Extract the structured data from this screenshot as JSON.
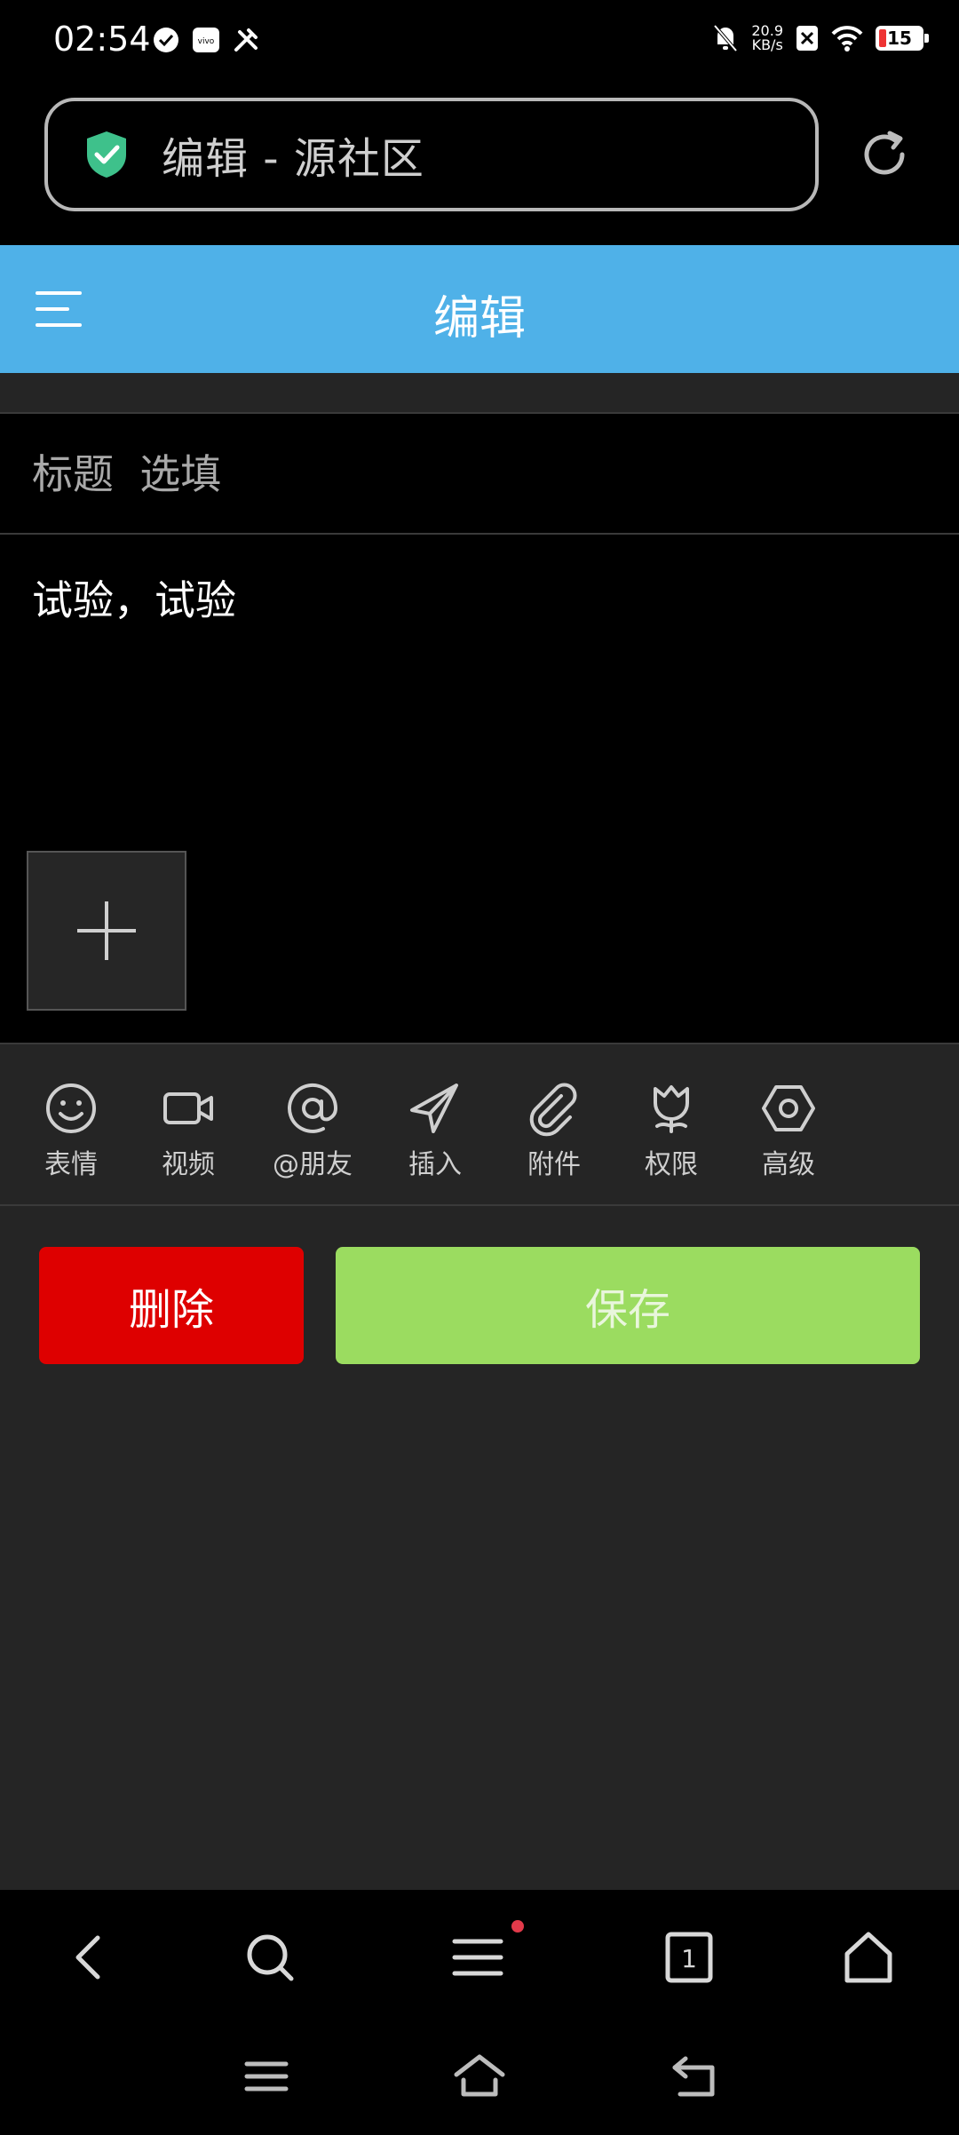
{
  "status_bar": {
    "time": "02:54",
    "net_speed_value": "20.9",
    "net_speed_unit": "KB/s",
    "battery": "15",
    "icons": [
      "check-circle-icon",
      "vivo-icon",
      "tools-icon",
      "bell-off-icon",
      "sim-off-icon",
      "wifi-icon",
      "battery-icon"
    ]
  },
  "address_bar": {
    "page_title": "编辑 - 源社区",
    "icons": [
      "shield-check-icon",
      "reload-icon"
    ]
  },
  "header": {
    "title": "编辑",
    "icons": [
      "menu-icon"
    ]
  },
  "editor": {
    "title_placeholder": "标题  选填",
    "title_value": "",
    "content": "试验，试验",
    "add_media_icon": "plus-icon"
  },
  "toolbar": {
    "items": [
      {
        "label": "表情",
        "icon": "emoji-icon"
      },
      {
        "label": "视频",
        "icon": "video-icon"
      },
      {
        "label": "@朋友",
        "icon": "at-icon"
      },
      {
        "label": "插入",
        "icon": "paper-plane-icon"
      },
      {
        "label": "附件",
        "icon": "paperclip-icon"
      },
      {
        "label": "权限",
        "icon": "tulip-icon"
      },
      {
        "label": "高级",
        "icon": "hex-gear-icon"
      }
    ]
  },
  "actions": {
    "delete_label": "删除",
    "save_label": "保存"
  },
  "colors": {
    "header_bg": "#4fb1e8",
    "delete_bg": "#de0000",
    "save_bg": "#9bdc60",
    "shield": "#3ec18b",
    "page_bg": "#252525"
  },
  "browser_nav": {
    "tab_count": "1",
    "icons": [
      "back-icon",
      "search-icon",
      "menu-lines-icon",
      "tabs-icon",
      "home-icon"
    ]
  },
  "system_nav": {
    "icons": [
      "recents-icon",
      "home-outline-icon",
      "back-arrow-icon"
    ]
  }
}
